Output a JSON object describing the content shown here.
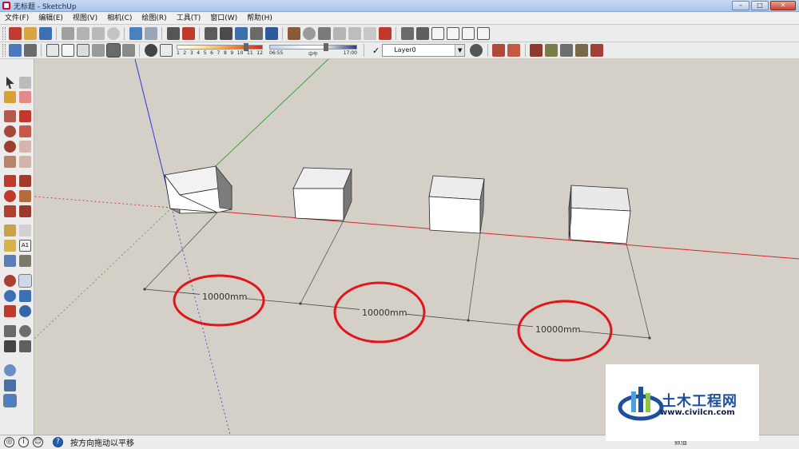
{
  "window": {
    "title": "无标题 - SketchUp",
    "controls": [
      "–",
      "□",
      "✕"
    ]
  },
  "menu": [
    "文件(F)",
    "编辑(E)",
    "视图(V)",
    "相机(C)",
    "绘图(R)",
    "工具(T)",
    "窗口(W)",
    "帮助(H)"
  ],
  "shadow_settings": {
    "month_labels": [
      "1",
      "2",
      "3",
      "4",
      "5",
      "6",
      "7",
      "8",
      "9",
      "10",
      "11",
      "12"
    ],
    "time_start": "06:55",
    "time_mid": "中午",
    "time_end": "17:00"
  },
  "layer": {
    "current": "Layer0"
  },
  "dimensions": [
    "10000mm",
    "10000mm",
    "10000mm"
  ],
  "status": {
    "message": "按方向拖动以平移",
    "measurements_label": "数值"
  },
  "watermark": {
    "name": "土木工程网",
    "url": "www.civilcn.com"
  },
  "colors": {
    "axis_red": "#d9252a",
    "axis_green": "#3aa63a",
    "axis_blue": "#2a3ad6",
    "highlight_circle": "#e0161a",
    "viewport_bg": "#d4d0c8"
  }
}
